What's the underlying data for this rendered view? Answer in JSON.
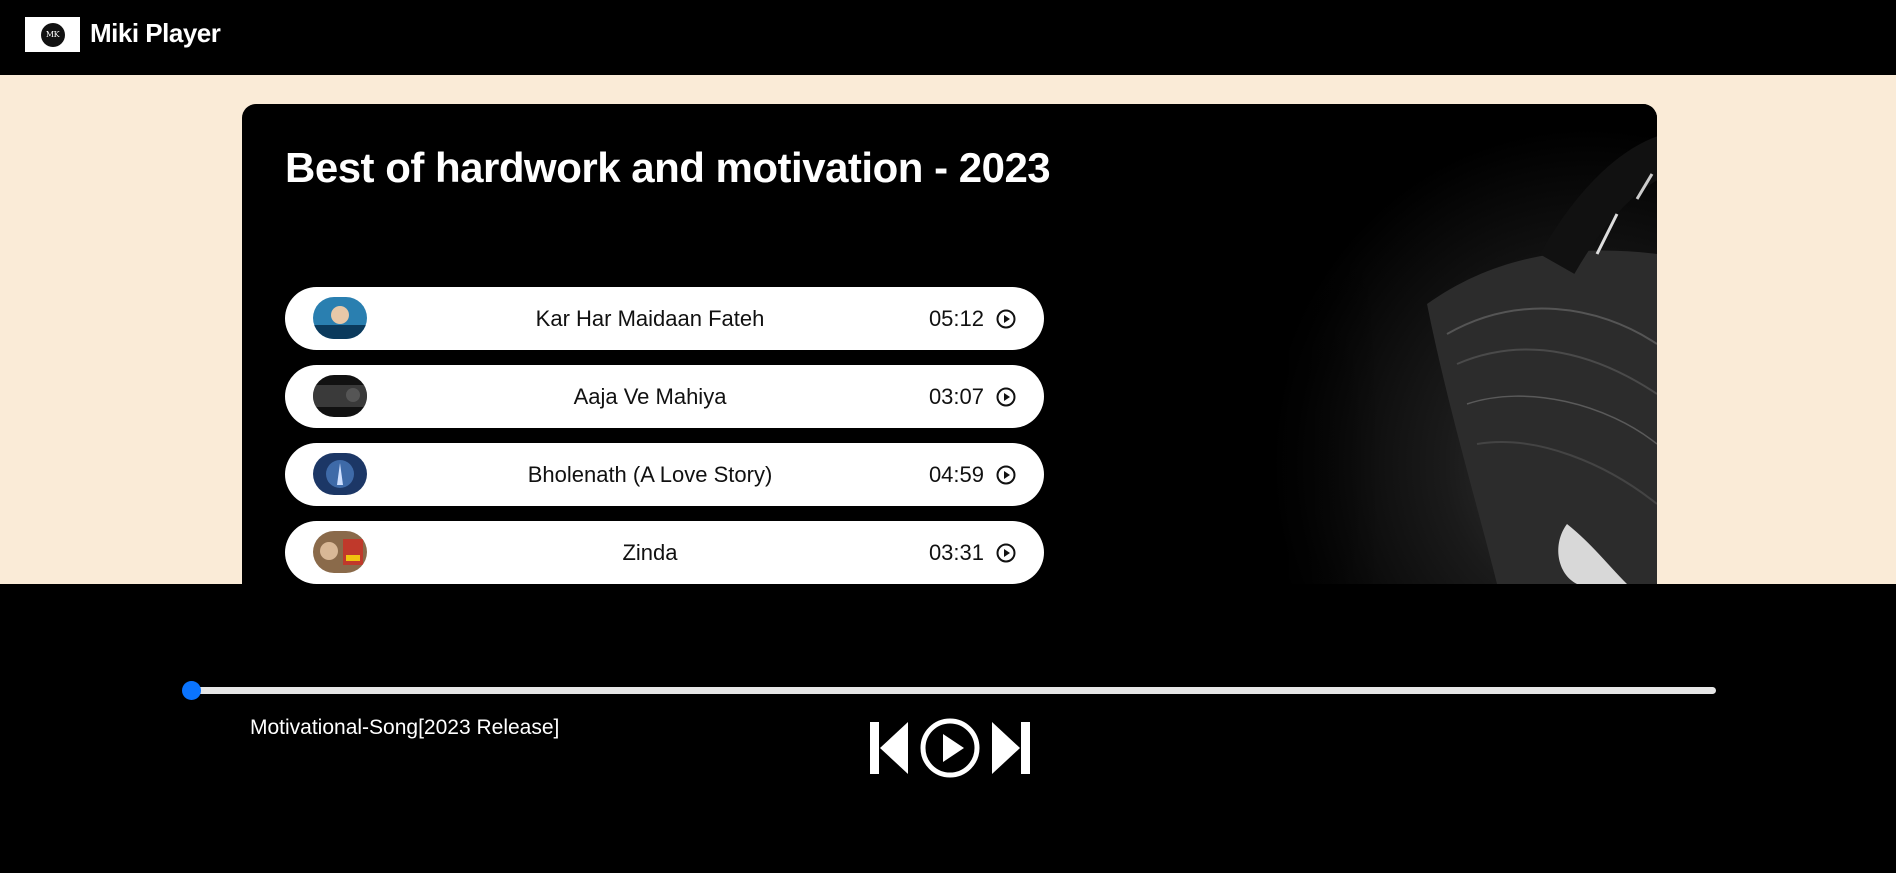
{
  "navbar": {
    "brand": "Miki Player",
    "logo_text": "MK"
  },
  "playlist": {
    "title": "Best of hardwork and motivation - 2023",
    "songs": [
      {
        "name": "Kar Har Maidaan Fateh",
        "duration": "05:12",
        "thumb_color": "#2a7fb0"
      },
      {
        "name": "Aaja Ve Mahiya",
        "duration": "03:07",
        "thumb_color": "#3a3a3a"
      },
      {
        "name": "Bholenath (A Love Story)",
        "duration": "04:59",
        "thumb_color": "#1c3766"
      },
      {
        "name": "Zinda",
        "duration": "03:31",
        "thumb_color": "#8a6a4a"
      }
    ]
  },
  "player": {
    "now_playing": "Motivational-Song[2023 Release]",
    "progress_fraction": 0.0,
    "icons": [
      "skip-back-icon",
      "play-icon",
      "skip-forward-icon"
    ]
  },
  "colors": {
    "accent": "#0a74ff",
    "page_bg": "#faebd7",
    "bar_bg": "#000000"
  }
}
